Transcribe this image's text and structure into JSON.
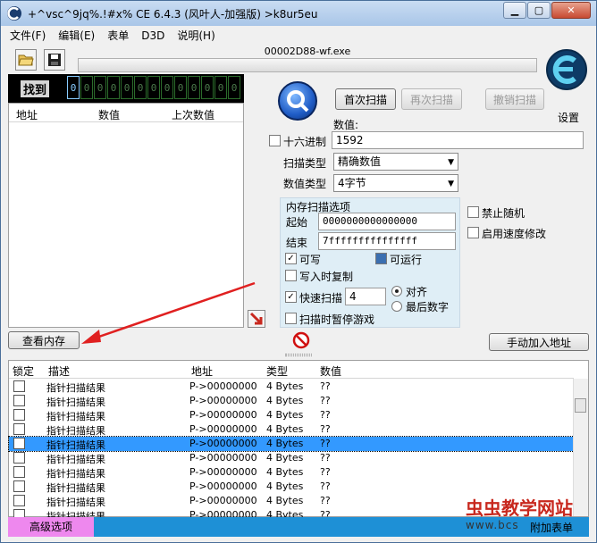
{
  "window": {
    "title": "+^vsc^9jq%.!#x%  CE 6.4.3 (风叶人-加强版)  >k8ur5eu",
    "controls": [
      "minimize-icon",
      "maximize-icon",
      "close-icon"
    ]
  },
  "menu": [
    "文件(F)",
    "编辑(E)",
    "表单",
    "D3D",
    "说明(H)"
  ],
  "toolbar": {
    "process_name": "00002D88-wf.exe",
    "open_icon": "folder-open-icon",
    "save_icon": "floppy-save-icon"
  },
  "logo": {
    "settings_label": "设置"
  },
  "found": {
    "label": "找到",
    "digits": [
      "0",
      "0",
      "0",
      "0",
      "0",
      "0",
      "0",
      "0",
      "0",
      "0",
      "0",
      "0",
      "0"
    ]
  },
  "results_header": {
    "address": "地址",
    "value": "数值",
    "previous": "上次数值"
  },
  "scan": {
    "first_scan": "首次扫描",
    "next_scan": "再次扫描",
    "undo_scan": "撤销扫描",
    "value_label": "数值:",
    "hex_label": "十六进制",
    "value": "1592",
    "scan_type_label": "扫描类型",
    "scan_type": "精确数值",
    "value_type_label": "数值类型",
    "value_type": "4字节"
  },
  "memory_options": {
    "title": "内存扫描选项",
    "start_label": "起始",
    "start_value": "0000000000000000",
    "end_label": "结束",
    "end_value": "7fffffffffffffff",
    "writable": "可写",
    "executable": "可运行",
    "copy_on_write": "写入时复制",
    "fast_scan": "快速扫描",
    "fast_scan_value": "4",
    "align": "对齐",
    "last_digit": "最后数字",
    "pause_game": "扫描时暂停游戏"
  },
  "side_options": {
    "disable_random": "禁止随机",
    "enable_speedhack": "启用速度修改"
  },
  "buttons": {
    "view_memory": "查看内存",
    "add_address": "手动加入地址"
  },
  "table": {
    "headers": {
      "lock": "锁定",
      "description": "描述",
      "address": "地址",
      "type": "类型",
      "value": "数值"
    },
    "rows": [
      {
        "description": "指针扫描结果",
        "address": "P->00000000",
        "type": "4 Bytes",
        "value": "??"
      },
      {
        "description": "指针扫描结果",
        "address": "P->00000000",
        "type": "4 Bytes",
        "value": "??"
      },
      {
        "description": "指针扫描结果",
        "address": "P->00000000",
        "type": "4 Bytes",
        "value": "??"
      },
      {
        "description": "指针扫描结果",
        "address": "P->00000000",
        "type": "4 Bytes",
        "value": "??"
      },
      {
        "description": "指针扫描结果",
        "address": "P->00000000",
        "type": "4 Bytes",
        "value": "??"
      },
      {
        "description": "指针扫描结果",
        "address": "P->00000000",
        "type": "4 Bytes",
        "value": "??"
      },
      {
        "description": "指针扫描结果",
        "address": "P->00000000",
        "type": "4 Bytes",
        "value": "??"
      },
      {
        "description": "指针扫描结果",
        "address": "P->00000000",
        "type": "4 Bytes",
        "value": "??"
      },
      {
        "description": "指针扫描结果",
        "address": "P->00000000",
        "type": "4 Bytes",
        "value": "??"
      },
      {
        "description": "指针扫描结果",
        "address": "P->00000000",
        "type": "4 Bytes",
        "value": "??"
      }
    ],
    "selected_row": 4
  },
  "status": {
    "advanced": "高级选项",
    "append": "附加表单"
  },
  "watermark": {
    "name": "虫虫教学网站",
    "url": "www.bcs"
  },
  "colors": {
    "selection": "#3399ff",
    "status_bar": "#1e90d6",
    "advanced_bg": "#ee88ee",
    "arrow": "#e02020"
  }
}
